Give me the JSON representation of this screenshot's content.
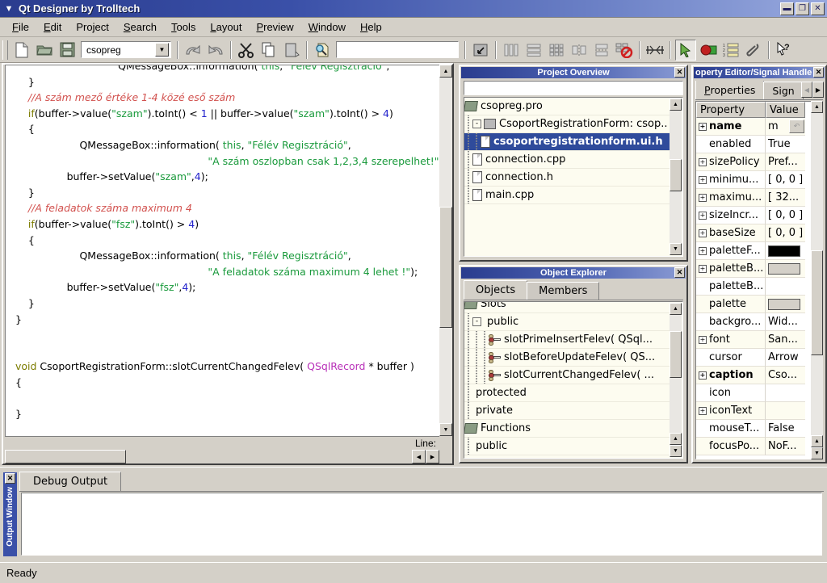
{
  "window": {
    "title": "Qt Designer by Trolltech",
    "sysmenu_icon": "chevron-down-icon",
    "buttons": [
      {
        "name": "minimize-button",
        "glyph": "–"
      },
      {
        "name": "maximize-button",
        "glyph": "❐"
      },
      {
        "name": "close-button",
        "glyph": "✕"
      }
    ]
  },
  "menubar": {
    "items": [
      {
        "label": "File",
        "accel": "F"
      },
      {
        "label": "Edit",
        "accel": "E"
      },
      {
        "label": "Project",
        "accel": "j"
      },
      {
        "label": "Search",
        "accel": "S"
      },
      {
        "label": "Tools",
        "accel": "T"
      },
      {
        "label": "Layout",
        "accel": "L"
      },
      {
        "label": "Preview",
        "accel": "P"
      },
      {
        "label": "Window",
        "accel": "W"
      },
      {
        "label": "Help",
        "accel": "H"
      }
    ]
  },
  "toolbar": {
    "project_combo_value": "csopreg",
    "search_field_value": "",
    "search_field_placeholder": "",
    "buttons": [
      {
        "name": "new-file-button",
        "icon": "new-file-icon"
      },
      {
        "name": "open-file-button",
        "icon": "open-folder-icon"
      },
      {
        "name": "save-file-button",
        "icon": "save-disk-icon"
      },
      {
        "name": "undo-button",
        "icon": "undo-arrow-icon"
      },
      {
        "name": "redo-button",
        "icon": "redo-arrow-icon"
      },
      {
        "name": "cut-button",
        "icon": "scissors-icon"
      },
      {
        "name": "copy-button",
        "icon": "copy-pages-icon"
      },
      {
        "name": "paste-button",
        "icon": "paste-clipboard-icon"
      },
      {
        "name": "find-button",
        "icon": "find-magnifier-icon"
      },
      {
        "name": "adjust-size-button",
        "icon": "adjust-size-icon"
      },
      {
        "name": "layout-horizontal-button",
        "icon": "layout-horizontal-icon"
      },
      {
        "name": "layout-vertical-button",
        "icon": "layout-vertical-icon"
      },
      {
        "name": "layout-grid-button",
        "icon": "layout-grid-icon"
      },
      {
        "name": "layout-splitter-horizontal-button",
        "icon": "splitter-horizontal-icon"
      },
      {
        "name": "layout-splitter-vertical-button",
        "icon": "splitter-vertical-icon"
      },
      {
        "name": "break-layout-button",
        "icon": "break-layout-icon"
      },
      {
        "name": "add-spacer-button",
        "icon": "spacer-icon"
      },
      {
        "name": "pointer-tool-button",
        "icon": "arrow-pointer-icon"
      },
      {
        "name": "connect-signals-button",
        "icon": "connect-signals-icon"
      },
      {
        "name": "tab-order-button",
        "icon": "tab-order-icon"
      },
      {
        "name": "buddy-tool-button",
        "icon": "buddy-paperclip-icon"
      },
      {
        "name": "whats-this-button",
        "icon": "whats-this-icon"
      }
    ]
  },
  "editor": {
    "status_label": "Line:",
    "lines": [
      {
        "indent": 8,
        "tokens": [
          {
            "t": "QMessageBox::information( ",
            "c": "plain"
          },
          {
            "t": "this",
            "c": "this"
          },
          {
            "t": ", ",
            "c": "plain"
          },
          {
            "t": "\"Félév Regisztráció\"",
            "c": "str"
          },
          {
            "t": ", ",
            "c": "plain"
          }
        ]
      },
      {
        "indent": 1,
        "tokens": [
          {
            "t": "}",
            "c": "plain"
          }
        ]
      },
      {
        "indent": 1,
        "tokens": [
          {
            "t": "//A szám mező értéke 1-4 közé eső szám",
            "c": "comment"
          }
        ]
      },
      {
        "indent": 1,
        "tokens": [
          {
            "t": "if",
            "c": "kw"
          },
          {
            "t": "(buffer->value(",
            "c": "plain"
          },
          {
            "t": "\"szam\"",
            "c": "str"
          },
          {
            "t": ").toInt() < ",
            "c": "plain"
          },
          {
            "t": "1",
            "c": "num"
          },
          {
            "t": " || buffer->value(",
            "c": "plain"
          },
          {
            "t": "\"szam\"",
            "c": "str"
          },
          {
            "t": ").toInt() > ",
            "c": "plain"
          },
          {
            "t": "4",
            "c": "num"
          },
          {
            "t": ")",
            "c": "plain"
          }
        ]
      },
      {
        "indent": 1,
        "tokens": [
          {
            "t": "{",
            "c": "plain"
          }
        ]
      },
      {
        "indent": 5,
        "tokens": [
          {
            "t": "QMessageBox::information( ",
            "c": "plain"
          },
          {
            "t": "this",
            "c": "this"
          },
          {
            "t": ", ",
            "c": "plain"
          },
          {
            "t": "\"Félév Regisztráció\"",
            "c": "str"
          },
          {
            "t": ",",
            "c": "plain"
          }
        ]
      },
      {
        "indent": 15,
        "tokens": [
          {
            "t": "\"A szám oszlopban csak 1,2,3,4 szerepelhet!\"",
            "c": "str"
          },
          {
            "t": ");",
            "c": "plain"
          }
        ]
      },
      {
        "indent": 4,
        "tokens": [
          {
            "t": "buffer->setValue(",
            "c": "plain"
          },
          {
            "t": "\"szam\"",
            "c": "str"
          },
          {
            "t": ",",
            "c": "plain"
          },
          {
            "t": "4",
            "c": "num"
          },
          {
            "t": ");",
            "c": "plain"
          }
        ]
      },
      {
        "indent": 1,
        "tokens": [
          {
            "t": "}",
            "c": "plain"
          }
        ]
      },
      {
        "indent": 1,
        "tokens": [
          {
            "t": "//A feladatok száma maximum 4",
            "c": "comment"
          }
        ]
      },
      {
        "indent": 1,
        "tokens": [
          {
            "t": "if",
            "c": "kw"
          },
          {
            "t": "(buffer->value(",
            "c": "plain"
          },
          {
            "t": "\"fsz\"",
            "c": "str"
          },
          {
            "t": ").toInt() > ",
            "c": "plain"
          },
          {
            "t": "4",
            "c": "num"
          },
          {
            "t": ")",
            "c": "plain"
          }
        ]
      },
      {
        "indent": 1,
        "tokens": [
          {
            "t": "{",
            "c": "plain"
          }
        ]
      },
      {
        "indent": 5,
        "tokens": [
          {
            "t": "QMessageBox::information( ",
            "c": "plain"
          },
          {
            "t": "this",
            "c": "this"
          },
          {
            "t": ", ",
            "c": "plain"
          },
          {
            "t": "\"Félév Regisztráció\"",
            "c": "str"
          },
          {
            "t": ",",
            "c": "plain"
          }
        ]
      },
      {
        "indent": 15,
        "tokens": [
          {
            "t": "\"A feladatok száma maximum 4 lehet !\"",
            "c": "str"
          },
          {
            "t": ");",
            "c": "plain"
          }
        ]
      },
      {
        "indent": 4,
        "tokens": [
          {
            "t": "buffer->setValue(",
            "c": "plain"
          },
          {
            "t": "\"fsz\"",
            "c": "str"
          },
          {
            "t": ",",
            "c": "plain"
          },
          {
            "t": "4",
            "c": "num"
          },
          {
            "t": ");",
            "c": "plain"
          }
        ]
      },
      {
        "indent": 1,
        "tokens": [
          {
            "t": "}",
            "c": "plain"
          }
        ]
      },
      {
        "indent": 0,
        "tokens": [
          {
            "t": "}",
            "c": "plain"
          }
        ]
      },
      {
        "indent": 0,
        "tokens": []
      },
      {
        "indent": 0,
        "tokens": []
      },
      {
        "indent": 0,
        "tokens": [
          {
            "t": "void",
            "c": "kw"
          },
          {
            "t": " CsoportRegistrationForm::slotCurrentChangedFelev( ",
            "c": "plain"
          },
          {
            "t": "QSqlRecord",
            "c": "type"
          },
          {
            "t": " * buffer )",
            "c": "plain"
          }
        ]
      },
      {
        "indent": 0,
        "tokens": [
          {
            "t": "{",
            "c": "plain"
          }
        ]
      },
      {
        "indent": 0,
        "tokens": []
      },
      {
        "indent": 0,
        "tokens": [
          {
            "t": "}",
            "c": "plain"
          }
        ]
      }
    ]
  },
  "project_overview": {
    "title": "Project Overview",
    "close_icon": "close-icon",
    "filter_value": "",
    "rows": [
      {
        "label": "csopreg.pro",
        "icon": "project-folder-icon",
        "depth": 0,
        "expander": "",
        "selected": false
      },
      {
        "label": "CsoportRegistrationForm: csop...",
        "icon": "form-folder-icon",
        "depth": 1,
        "expander": "-",
        "selected": false
      },
      {
        "label": "csoportregistrationform.ui.h",
        "icon": "file-icon",
        "depth": 2,
        "expander": "",
        "selected": true
      },
      {
        "label": "connection.cpp",
        "icon": "file-icon",
        "depth": 1,
        "expander": "",
        "selected": false
      },
      {
        "label": "connection.h",
        "icon": "file-icon",
        "depth": 1,
        "expander": "",
        "selected": false
      },
      {
        "label": "main.cpp",
        "icon": "file-icon",
        "depth": 1,
        "expander": "",
        "selected": false
      }
    ]
  },
  "object_explorer": {
    "title": "Object Explorer",
    "close_icon": "close-icon",
    "tabs": [
      {
        "label": "Objects",
        "active": true
      },
      {
        "label": "Members",
        "active": false
      }
    ],
    "rows": [
      {
        "label": "Slots",
        "icon": "folder-icon",
        "depth": 0,
        "expander": "",
        "clipped": true
      },
      {
        "label": "public",
        "icon": "none",
        "depth": 1,
        "expander": "-",
        "clipped": false
      },
      {
        "label": "slotPrimeInsertFelev( QSql...",
        "icon": "slot-icon",
        "depth": 3,
        "expander": "",
        "clipped": false
      },
      {
        "label": "slotBeforeUpdateFelev( QS...",
        "icon": "slot-icon",
        "depth": 3,
        "expander": "",
        "clipped": false
      },
      {
        "label": "slotCurrentChangedFelev( ...",
        "icon": "slot-icon",
        "depth": 3,
        "expander": "",
        "clipped": false
      },
      {
        "label": "protected",
        "icon": "none",
        "depth": 1,
        "expander": "",
        "clipped": false
      },
      {
        "label": "private",
        "icon": "none",
        "depth": 1,
        "expander": "",
        "clipped": false
      },
      {
        "label": "Functions",
        "icon": "folder-icon",
        "depth": 0,
        "expander": "",
        "clipped": false
      },
      {
        "label": "public",
        "icon": "none",
        "depth": 1,
        "expander": "",
        "clipped": false
      }
    ]
  },
  "property_editor": {
    "title": "Property Editor/Signal Handlers",
    "title_clipped": "operty Editor/Signal Handle",
    "close_icon": "close-icon",
    "tabs": [
      {
        "label": "Properties",
        "active": true
      },
      {
        "label": "Signal Handlers",
        "label_clipped": "Sign",
        "active": false
      }
    ],
    "scroll_left_icon": "triangle-left-icon",
    "scroll_right_icon": "triangle-right-icon",
    "columns": [
      "Property",
      "Value"
    ],
    "rows": [
      {
        "name": "name",
        "value": "m",
        "expandable": true,
        "bold": true,
        "kind": "text",
        "revert": true
      },
      {
        "name": "enabled",
        "value": "True",
        "expandable": false,
        "bold": false,
        "kind": "text"
      },
      {
        "name": "sizePolicy",
        "value": "Pref...",
        "expandable": true,
        "bold": false,
        "kind": "text"
      },
      {
        "name": "minimu...",
        "value": "[ 0, 0 ]",
        "expandable": true,
        "bold": false,
        "kind": "text"
      },
      {
        "name": "maximu...",
        "value": "[ 32...",
        "expandable": true,
        "bold": false,
        "kind": "text"
      },
      {
        "name": "sizeIncr...",
        "value": "[ 0, 0 ]",
        "expandable": true,
        "bold": false,
        "kind": "text"
      },
      {
        "name": "baseSize",
        "value": "[ 0, 0 ]",
        "expandable": true,
        "bold": false,
        "kind": "text"
      },
      {
        "name": "paletteF...",
        "value": "",
        "expandable": true,
        "bold": false,
        "kind": "color",
        "color": "#000000"
      },
      {
        "name": "paletteB...",
        "value": "",
        "expandable": true,
        "bold": false,
        "kind": "color",
        "color": "#d4d0c8"
      },
      {
        "name": "paletteB...",
        "value": "",
        "expandable": false,
        "bold": false,
        "kind": "text"
      },
      {
        "name": "palette",
        "value": "",
        "expandable": false,
        "bold": false,
        "kind": "color",
        "color": "#d4d0c8"
      },
      {
        "name": "backgro...",
        "value": "Wid...",
        "expandable": false,
        "bold": false,
        "kind": "text"
      },
      {
        "name": "font",
        "value": "San...",
        "expandable": true,
        "bold": false,
        "kind": "text"
      },
      {
        "name": "cursor",
        "value": "Arrow",
        "expandable": false,
        "bold": false,
        "kind": "text"
      },
      {
        "name": "caption",
        "value": "Cso...",
        "expandable": true,
        "bold": true,
        "kind": "text"
      },
      {
        "name": "icon",
        "value": "",
        "expandable": false,
        "bold": false,
        "kind": "text"
      },
      {
        "name": "iconText",
        "value": "",
        "expandable": true,
        "bold": false,
        "kind": "text"
      },
      {
        "name": "mouseT...",
        "value": "False",
        "expandable": false,
        "bold": false,
        "kind": "text"
      },
      {
        "name": "focusPo...",
        "value": "NoF...",
        "expandable": false,
        "bold": false,
        "kind": "text"
      }
    ]
  },
  "output_window": {
    "handle_label": "Output Window",
    "close_icon": "close-icon",
    "tabs": [
      {
        "label": "Debug Output",
        "active": true
      }
    ],
    "content": ""
  },
  "statusbar": {
    "message": "Ready"
  },
  "colors": {
    "titlebar_start": "#2a3c8e",
    "titlebar_end": "#97a8dd",
    "face": "#d4d0c8",
    "selection": "#2f4b9b",
    "tree_bg": "#fdfcf0",
    "comment": "#d2524f",
    "string": "#1a9a3c",
    "keyword": "#7c7c00",
    "number": "#2222cc",
    "type": "#b830b8"
  }
}
